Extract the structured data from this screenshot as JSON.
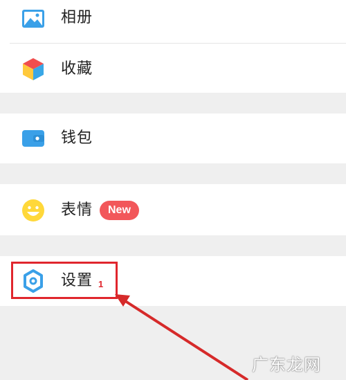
{
  "menu": {
    "album": {
      "label": "相册",
      "icon": "album-icon"
    },
    "favorites": {
      "label": "收藏",
      "icon": "favorites-cube-icon"
    },
    "wallet": {
      "label": "钱包",
      "icon": "wallet-icon"
    },
    "stickers": {
      "label": "表情",
      "icon": "smiley-icon",
      "badge": "New"
    },
    "settings": {
      "label": "设置",
      "icon": "gear-icon"
    }
  },
  "annotation": {
    "step_number": "1"
  },
  "watermark": "广东龙网",
  "colors": {
    "accent_blue": "#3aa0e8",
    "badge_red": "#f2575a",
    "annotation_red": "#e0262d",
    "background": "#efefef"
  }
}
